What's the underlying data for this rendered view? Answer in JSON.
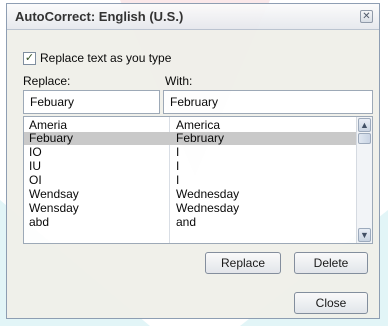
{
  "window": {
    "title": "AutoCorrect: English (U.S.)",
    "close_glyph": "✕"
  },
  "option": {
    "checked": true,
    "label": "Replace text as you type"
  },
  "columns": {
    "replace_label": "Replace:",
    "with_label": "With:"
  },
  "fields": {
    "replace_value": "Febuary",
    "with_value": "February"
  },
  "list": {
    "selected_index": 1,
    "rows": [
      {
        "replace": "Ameria",
        "with": "America"
      },
      {
        "replace": "Febuary",
        "with": "February"
      },
      {
        "replace": "IO",
        "with": "I"
      },
      {
        "replace": "IU",
        "with": "I"
      },
      {
        "replace": "OI",
        "with": "I"
      },
      {
        "replace": "Wendsay",
        "with": "Wednesday"
      },
      {
        "replace": "Wensday",
        "with": "Wednesday"
      },
      {
        "replace": "abd",
        "with": "and"
      }
    ]
  },
  "buttons": {
    "replace": "Replace",
    "delete": "Delete",
    "close": "Close"
  },
  "scroll": {
    "up_glyph": "▲",
    "down_glyph": "▼"
  },
  "colors": {
    "watermark_red": "#d9232f",
    "watermark_cyan": "#1eb8c8",
    "selection": "#c7c7c7"
  }
}
